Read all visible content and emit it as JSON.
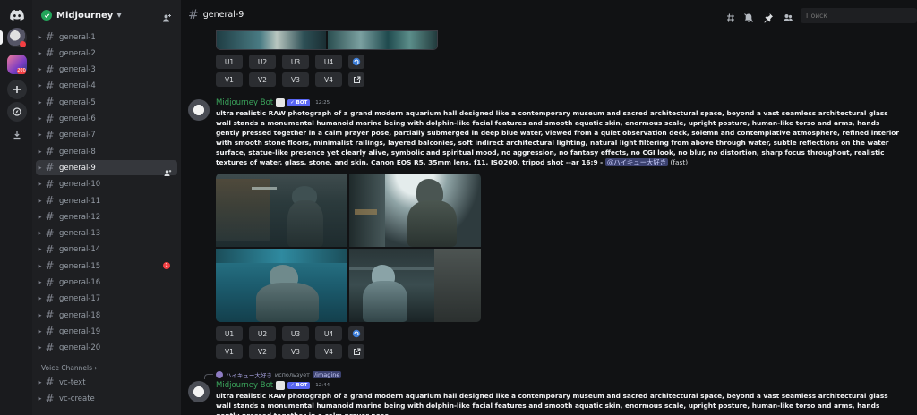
{
  "server": {
    "name": "Midjourney",
    "chevron": "chevron-down-icon"
  },
  "rail": {
    "server2_badge": "200",
    "server1_badge": ""
  },
  "channels": [
    {
      "name": "general-1"
    },
    {
      "name": "general-2"
    },
    {
      "name": "general-3"
    },
    {
      "name": "general-4"
    },
    {
      "name": "general-5"
    },
    {
      "name": "general-6"
    },
    {
      "name": "general-7"
    },
    {
      "name": "general-8"
    },
    {
      "name": "general-9"
    },
    {
      "name": "general-10"
    },
    {
      "name": "general-11"
    },
    {
      "name": "general-12"
    },
    {
      "name": "general-13"
    },
    {
      "name": "general-14"
    },
    {
      "name": "general-15",
      "unread": "1"
    },
    {
      "name": "general-16"
    },
    {
      "name": "general-17"
    },
    {
      "name": "general-18"
    },
    {
      "name": "general-19"
    },
    {
      "name": "general-20"
    }
  ],
  "active_channel_index": 8,
  "voice_category": "Voice Channels ›",
  "voice_channels": [
    {
      "name": "vc-text"
    },
    {
      "name": "vc-create"
    }
  ],
  "topbar": {
    "channel": "general-9",
    "search_placeholder": "Поиск"
  },
  "upscale_buttons": [
    "U1",
    "U2",
    "U3",
    "U4"
  ],
  "variation_buttons": [
    "V1",
    "V2",
    "V3",
    "V4"
  ],
  "message1": {
    "author": "Midjourney Bot",
    "tag": "✓ BOT",
    "time": "12:25",
    "prompt": "ultra realistic RAW photograph of a grand modern aquarium hall designed like a contemporary museum and sacred architectural space, beyond a vast seamless architectural glass wall stands a monumental humanoid marine being with dolphin-like facial features and smooth aquatic skin, enormous scale, upright posture, human-like torso and arms, hands gently pressed together in a calm prayer pose, partially submerged in deep blue water, viewed from a quiet observation deck, solemn and contemplative atmosphere, refined interior with smooth stone floors, minimalist railings, layered balconies, soft indirect architectural lighting, natural light filtering from above through water, subtle reflections on the water surface, statue-like presence yet clearly alive, symbolic and spiritual mood, no aggression, no fantasy effects, no CGI look, no blur, no distortion, sharp focus throughout, realistic textures of water, glass, stone, and skin, Canon EOS R5, 35mm lens, f11, ISO200, tripod shot --ar 16:9",
    "separator": " - ",
    "mention": "@ハイキュー大好き",
    "speed": " (fast)"
  },
  "reply": {
    "user": "ハイキュー大好き",
    "verb": "использует",
    "command": "/imagine"
  },
  "message2": {
    "author": "Midjourney Bot",
    "tag": "✓ BOT",
    "time": "12:44",
    "prompt": "ultra realistic RAW photograph of a grand modern aquarium hall designed like a contemporary museum and sacred architectural space, beyond a vast seamless architectural glass wall stands a monumental humanoid marine being with dolphin-like facial features and smooth aquatic skin, enormous scale, upright posture, human-like torso and arms, hands gently pressed together in a calm prayer pose"
  },
  "colors": {
    "accent": "#5865f2",
    "bot_name": "#3ba55c",
    "unread": "#f23f43",
    "online": "#23a55a"
  }
}
